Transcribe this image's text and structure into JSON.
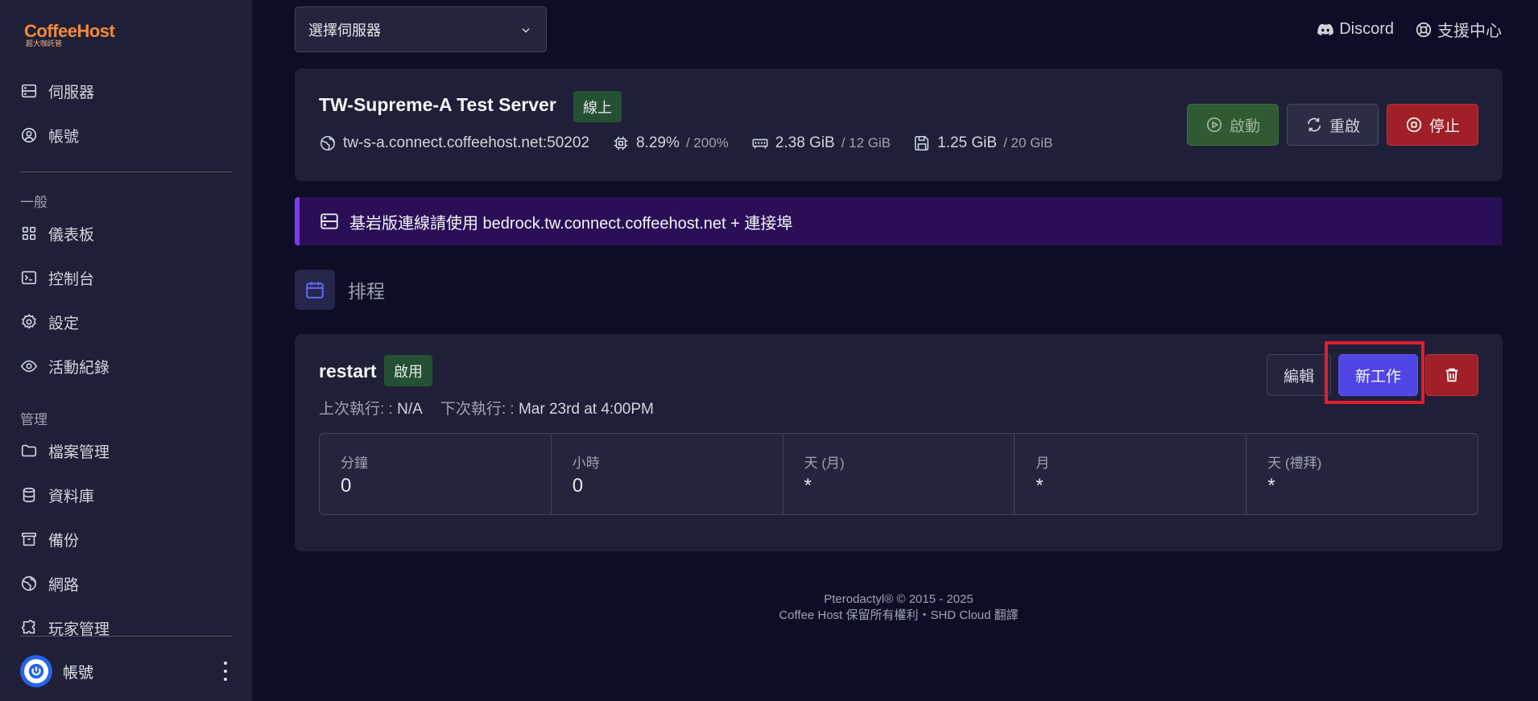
{
  "sidebar": {
    "logo": {
      "brand": "CoffeeHost",
      "sub": "超大咖託管"
    },
    "top_items": [
      {
        "label": "伺服器",
        "icon": "server-icon"
      },
      {
        "label": "帳號",
        "icon": "user-circle-icon"
      }
    ],
    "section_general": "一般",
    "general_items": [
      {
        "label": "儀表板",
        "icon": "grid-icon"
      },
      {
        "label": "控制台",
        "icon": "terminal-icon"
      },
      {
        "label": "設定",
        "icon": "gear-icon"
      },
      {
        "label": "活動紀錄",
        "icon": "eye-icon"
      }
    ],
    "section_manage": "管理",
    "manage_items": [
      {
        "label": "檔案管理",
        "icon": "folder-icon"
      },
      {
        "label": "資料庫",
        "icon": "database-icon"
      },
      {
        "label": "備份",
        "icon": "archive-icon"
      },
      {
        "label": "網路",
        "icon": "globe-icon"
      },
      {
        "label": "玩家管理",
        "icon": "puzzle-icon"
      }
    ],
    "user": {
      "label": "帳號"
    }
  },
  "topbar": {
    "server_select": "選擇伺服器",
    "links": [
      {
        "label": "Discord",
        "icon": "discord-icon"
      },
      {
        "label": "支援中心",
        "icon": "lifebuoy-icon"
      }
    ]
  },
  "server": {
    "name": "TW-Supreme-A Test Server",
    "status": "線上",
    "address": "tw-s-a.connect.coffeehost.net:50202",
    "cpu": "8.29%",
    "cpu_limit": "/ 200%",
    "memory": "2.38 GiB",
    "memory_limit": "/ 12 GiB",
    "disk": "1.25 GiB",
    "disk_limit": "/ 20 GiB",
    "buttons": {
      "start": "啟動",
      "restart": "重啟",
      "stop": "停止"
    }
  },
  "notice": "基岩版連線請使用 bedrock.tw.connect.coffeehost.net + 連接埠",
  "section_title": "排程",
  "schedule": {
    "name": "restart",
    "status": "啟用",
    "last_run_label": "上次執行: :",
    "last_run_value": "N/A",
    "next_run_label": "下次執行: :",
    "next_run_value": "Mar 23rd at 4:00PM",
    "buttons": {
      "edit": "編輯",
      "new_task": "新工作"
    },
    "cron": [
      {
        "label": "分鐘",
        "value": "0"
      },
      {
        "label": "小時",
        "value": "0"
      },
      {
        "label": "天 (月)",
        "value": "*"
      },
      {
        "label": "月",
        "value": "*"
      },
      {
        "label": "天 (禮拜)",
        "value": "*"
      }
    ]
  },
  "footer": {
    "line1": "Pterodactyl® © 2015 - 2025",
    "line2": "Coffee Host 保留所有權利・SHD Cloud 翻譯"
  }
}
